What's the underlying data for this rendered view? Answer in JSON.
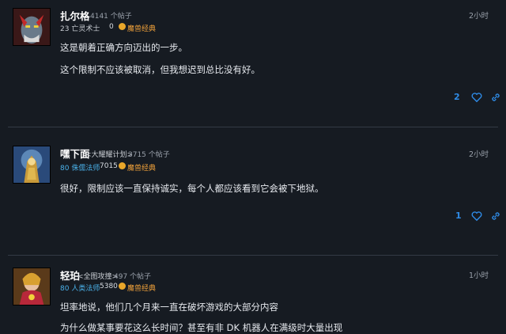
{
  "posts": [
    {
      "author": "扎尔格",
      "guild": "",
      "post_count": "4141 个帖子",
      "level_class": "23 亡灵术士",
      "level_class_color": "#c8ccd2",
      "achievements": "0",
      "badge_label": "魔兽经典",
      "time": "2小时",
      "lines": [
        "这是朝着正确方向迈出的一步。",
        "这个限制不应该被取消，但我想迟到总比没有好。"
      ],
      "likes": "2"
    },
    {
      "author": "嘿下面",
      "guild": "<大耀耀计划>",
      "post_count": "3715 个帖子",
      "level_class": "80 侏儒法师",
      "level_class_color": "#4ab0e8",
      "achievements": "7015",
      "badge_label": "魔兽经典",
      "time": "2小时",
      "lines": [
        "很好，限制应该一直保持诚实，每个人都应该看到它会被下地狱。"
      ],
      "likes": "1"
    },
    {
      "author": "轻珀",
      "guild": "<全图攻撞>",
      "post_count": "497 个帖子",
      "level_class": "80 人类法师",
      "level_class_color": "#4ab0e8",
      "achievements": "5380",
      "badge_label": "魔兽经典",
      "time": "1小时",
      "lines": [
        "坦率地说，他们几个月来一直在破坏游戏的大部分内容",
        "为什么做某事要花这么长时间？甚至有非 DK 机器人在满级时大量出现"
      ],
      "likes": ""
    }
  ],
  "icons": {
    "like": "heart-icon",
    "share": "link-icon"
  },
  "colors": {
    "accent": "#2f8be6",
    "badge": "#e8a62a",
    "background": "#161b22"
  }
}
